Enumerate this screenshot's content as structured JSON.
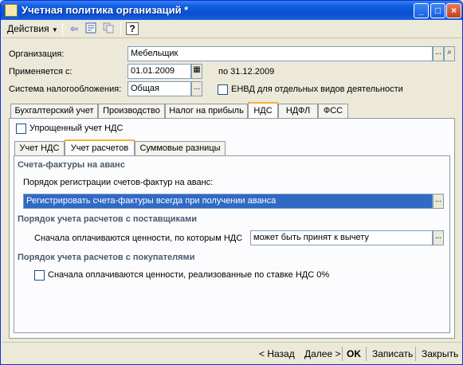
{
  "window": {
    "title": "Учетная политика организаций *"
  },
  "titlebar_buttons": {
    "minimize": "_",
    "maximize": "□",
    "close": "×"
  },
  "toolbar": {
    "actions_label": "Действия",
    "help_label": "?"
  },
  "header": {
    "org_label": "Организация:",
    "org_value": "Мебельщик",
    "applies_label": "Применяется с:",
    "applies_value": "01.01.2009",
    "until_text": "по 31.12.2009",
    "tax_label": "Система налогообложения:",
    "tax_value": "Общая",
    "envd_label": "ЕНВД для отдельных видов деятельности",
    "ellipsis": "...",
    "search_glyph": "⌕",
    "calendar_glyph": "▦"
  },
  "tabs": [
    {
      "label": "Бухгалтерский учет"
    },
    {
      "label": "Производство"
    },
    {
      "label": "Налог на прибыль"
    },
    {
      "label": "НДС"
    },
    {
      "label": "НДФЛ"
    },
    {
      "label": "ФСС"
    }
  ],
  "nds": {
    "simplified_label": "Упрощенный учет НДС",
    "subtabs": [
      {
        "label": "Учет НДС"
      },
      {
        "label": "Учет расчетов"
      },
      {
        "label": "Суммовые разницы"
      }
    ],
    "invoices_head": "Счета-фактуры на аванс",
    "invoices_order_label": "Порядок регистрации счетов-фактур на аванс:",
    "invoices_order_value": "Регистрировать счета-фактуры всегда при получении аванса",
    "suppliers_head": "Порядок учета расчетов с поставщиками",
    "suppliers_label": "Сначала оплачиваются ценности, по которым НДС",
    "suppliers_value": "может быть принят к вычету",
    "buyers_head": "Порядок учета расчетов с покупателями",
    "buyers_label": "Сначала оплачиваются ценности, реализованные по ставке НДС 0%"
  },
  "bottom": {
    "back_label": "< Назад",
    "next_label": "Далее >",
    "ok_label": "OK",
    "save_label": "Записать",
    "close_label": "Закрыть"
  },
  "colors": {
    "title_bar": "#0a50d0",
    "selection": "#316ac5",
    "tab_highlight": "#f1b23a"
  }
}
